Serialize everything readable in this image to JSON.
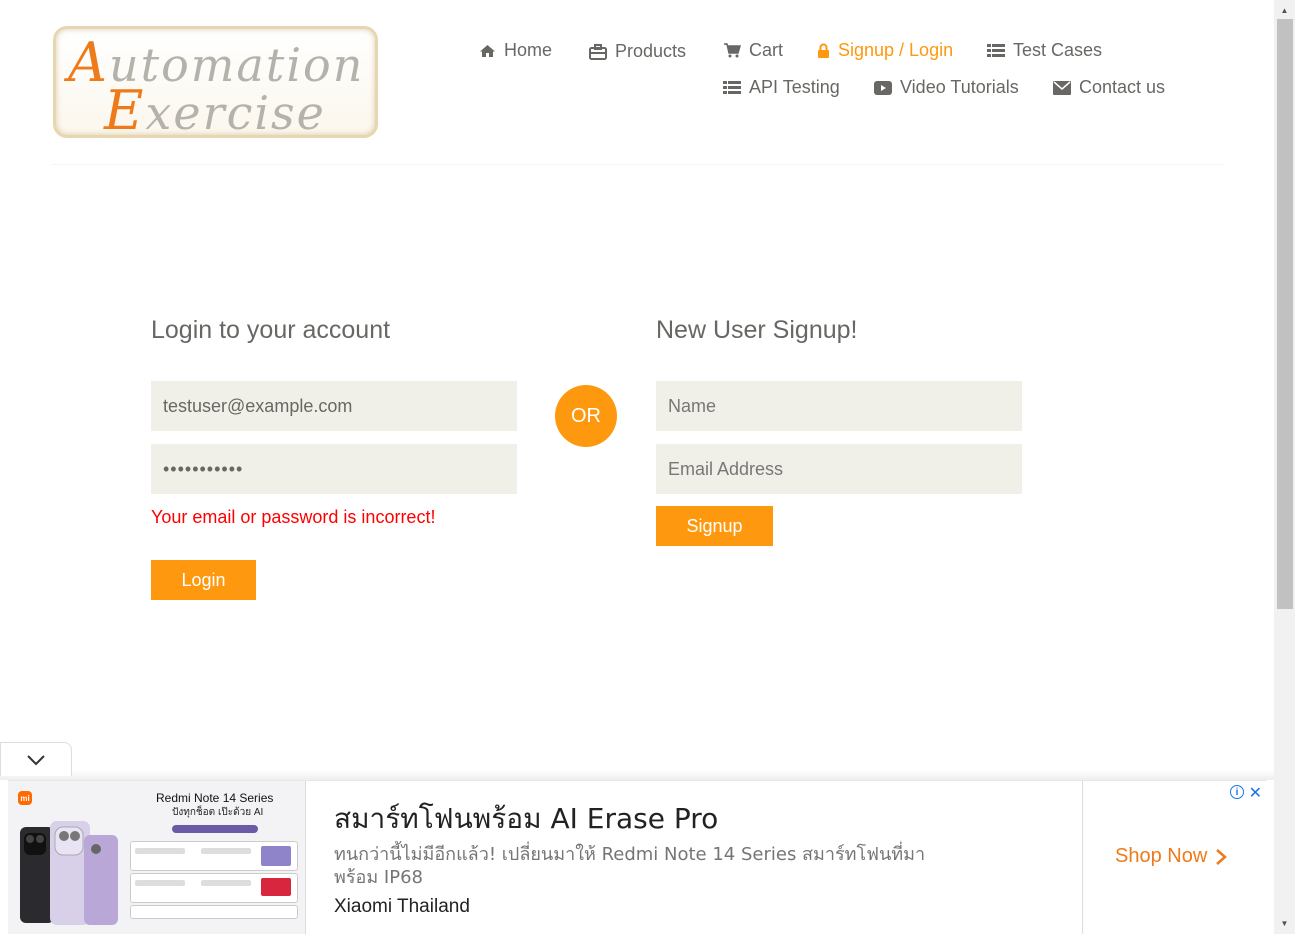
{
  "logo": {
    "line1": "Automation",
    "line2": "Exercise"
  },
  "nav": {
    "home": "Home",
    "products": "Products",
    "cart": "Cart",
    "login": "Signup / Login",
    "test_cases": "Test Cases",
    "api_testing": "API Testing",
    "video_tutorials": "Video Tutorials",
    "contact": "Contact us"
  },
  "login_form": {
    "title": "Login to your account",
    "email_value": "testuser@example.com",
    "password_value": "•••••••••••",
    "error": "Your email or password is incorrect!",
    "button": "Login"
  },
  "or_label": "OR",
  "signup_form": {
    "title": "New User Signup!",
    "name_placeholder": "Name",
    "email_placeholder": "Email Address",
    "button": "Signup"
  },
  "ad": {
    "image_title": "Redmi Note 14 Series",
    "image_subtitle": "ปังทุกช็อต เป๊ะด้วย AI",
    "headline": "สมาร์ทโฟนพร้อม AI Erase Pro",
    "description": "ทนกว่านี้ไม่มีอีกแล้ว! เปลี่ยนมาให้ Redmi Note 14 Series สมาร์ทโฟนที่มาพร้อม IP68",
    "brand": "Xiaomi Thailand",
    "cta": "Shop Now",
    "mi_logo": "mi"
  },
  "colors": {
    "accent": "#fe980f",
    "text": "#696763",
    "error": "#ff0000",
    "field_bg": "#f0f0e9"
  }
}
